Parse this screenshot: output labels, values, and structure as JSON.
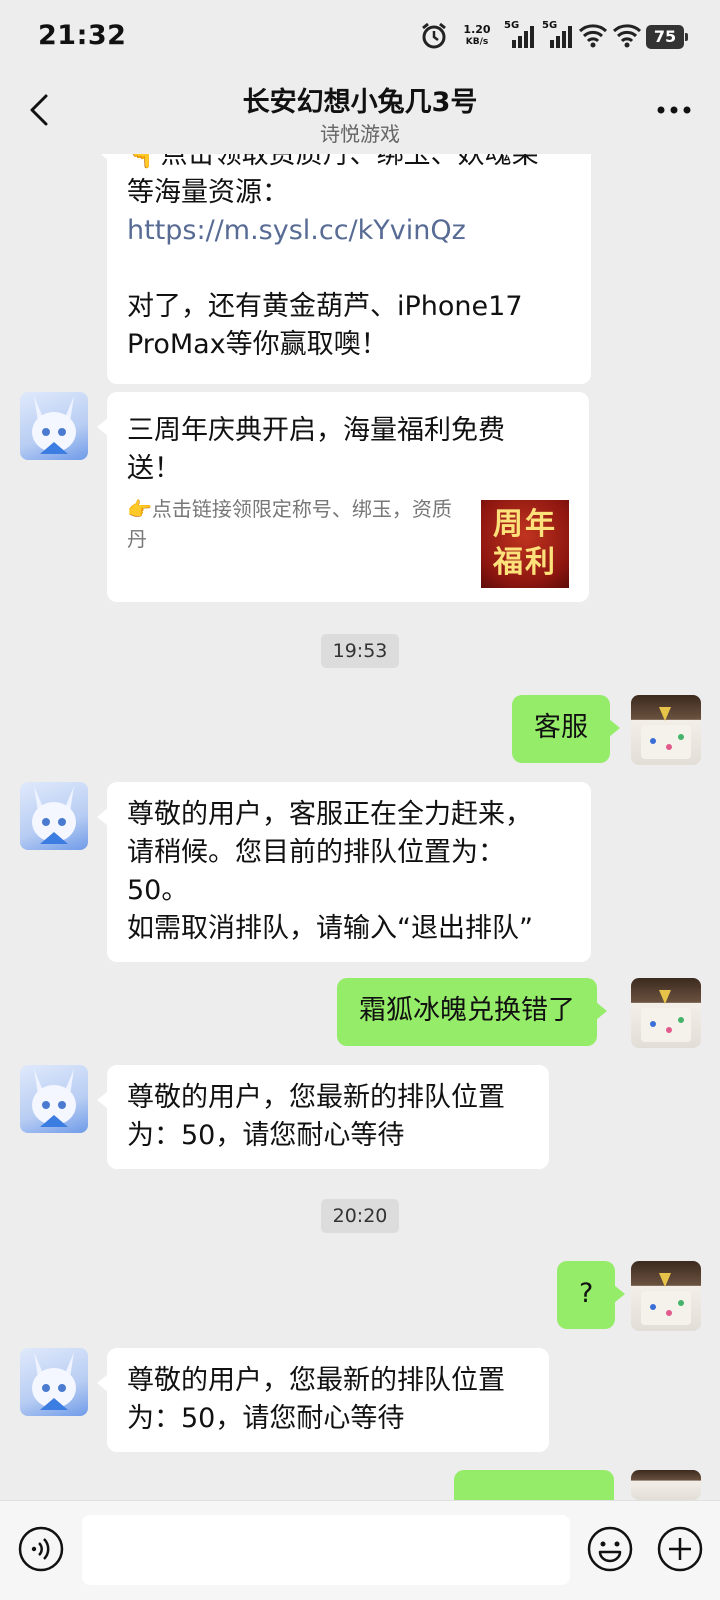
{
  "status_bar": {
    "time": "21:32",
    "net_speed_value": "1.20",
    "net_speed_unit": "KB/s",
    "signal1_label": "5G",
    "signal2_label": "5G",
    "battery": "75"
  },
  "header": {
    "title": "长安幻想小兔几3号",
    "subtitle": "诗悦游戏"
  },
  "messages": {
    "m1": {
      "line1": "👇点击领取资质丹、绑玉、妖魂果",
      "line2": "等海量资源：",
      "link": "https://m.sysl.cc/kYvinQz",
      "line3": "对了，还有黄金葫芦、iPhone17",
      "line4": "ProMax等你赢取噢！"
    },
    "m2": {
      "title": "三周年庆典开启，海量福利免费送！",
      "desc": "👉点击链接领限定称号、绑玉，资质丹",
      "thumb_line1": "周年",
      "thumb_line2": "福利"
    },
    "ts1": "19:53",
    "m3": "客服",
    "m4": {
      "line1": "尊敬的用户，客服正在全力赶来，",
      "line2": "请稍候。您目前的排队位置为：",
      "line3": "50。",
      "line4": "如需取消排队，请输入“退出排队”"
    },
    "m5": "霜狐冰魄兑换错了",
    "m6": {
      "line1": "尊敬的用户，您最新的排队位置",
      "line2": "为：50，请您耐心等待"
    },
    "ts2": "20:20",
    "m7": "?",
    "m8": {
      "line1": "尊敬的用户，您最新的排队位置",
      "line2": "为：50，请您耐心等待"
    }
  },
  "icons": {
    "back": "chevron-left-icon",
    "more": "more-dots-icon",
    "voice": "voice-icon",
    "emoji": "emoji-icon",
    "plus": "plus-icon"
  },
  "colors": {
    "background": "#ededed",
    "outgoing_bubble": "#95ec69",
    "incoming_bubble": "#ffffff",
    "link": "#576b95"
  }
}
